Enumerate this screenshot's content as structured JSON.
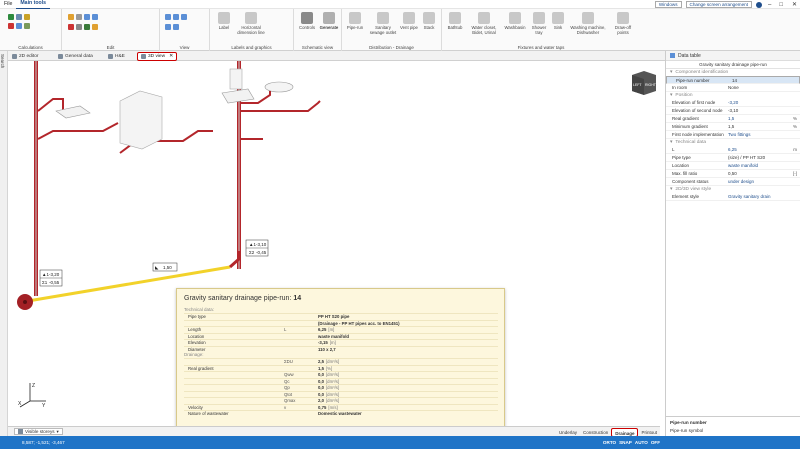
{
  "menu": {
    "file": "File",
    "main_tools": "Main tools",
    "windows": "Windows",
    "screen_arrangement": "Change screen arrangement"
  },
  "ribbon": {
    "groups": [
      {
        "label": "Calculations"
      },
      {
        "label": "Edit"
      },
      {
        "label": "View"
      },
      {
        "label": "Labels and graphics"
      },
      {
        "label": "Schematic view"
      },
      {
        "label": "Distribution - Drainage"
      },
      {
        "label": "Fixtures and water taps"
      }
    ],
    "buttons": [
      "Label",
      "Horizontal dimension line",
      "Controls",
      "Generate",
      "Pipe-run",
      "Sanitary sewage outlet",
      "Vent pipe",
      "Stack",
      "Bathtub",
      "Water closet, Bidet, Urinal",
      "Washbasin",
      "Shower tray",
      "Sink",
      "Washing machine, Dishwasher",
      "Draw-off points"
    ]
  },
  "tabs": [
    {
      "label": "2D editor"
    },
    {
      "label": "General data"
    },
    {
      "label": "H&E"
    },
    {
      "label": "3D view"
    }
  ],
  "side_tab": "Search",
  "viewcube": {
    "left": "LEFT",
    "right": "RIGHT"
  },
  "labels3d": {
    "l1a": "-3,10",
    "l1b": "-0,45",
    "l2a": "-3,20",
    "l2b": "-0,55",
    "l3": "1,50"
  },
  "tooltip": {
    "title_prefix": "Gravity sanitary drainage pipe-run:",
    "title_num": "14",
    "section1": "Technical data:",
    "section2": "Drainage:",
    "rows1": [
      {
        "a": "Pipe type",
        "b": "",
        "c": "PP HT S20 pipe",
        "u": ""
      },
      {
        "a": "",
        "b": "",
        "c": "(Drainage - PP HT pipes acc. to EN1451)",
        "u": ""
      },
      {
        "a": "Length",
        "b": "L",
        "c": "6,25",
        "u": "[m]"
      },
      {
        "a": "Location",
        "b": "",
        "c": "waste manifold",
        "u": ""
      },
      {
        "a": "Elevation",
        "b": "",
        "c": "-3,15",
        "u": "[m]"
      },
      {
        "a": "Diameter",
        "b": "",
        "c": "110 x 2,7",
        "u": ""
      }
    ],
    "rows2": [
      {
        "a": "",
        "b": "ΣDU",
        "c": "2,5",
        "u": "[dm³/s]"
      },
      {
        "a": "Real gradient",
        "b": "",
        "c": "1,5",
        "u": "[%]"
      },
      {
        "a": "",
        "b": "Qww",
        "c": "0,0",
        "u": "[dm³/s]"
      },
      {
        "a": "",
        "b": "Qc",
        "c": "0,0",
        "u": "[dm³/s]"
      },
      {
        "a": "",
        "b": "Qp",
        "c": "0,0",
        "u": "[dm³/s]"
      },
      {
        "a": "",
        "b": "Qtot",
        "c": "0,0",
        "u": "[dm³/s]"
      },
      {
        "a": "",
        "b": "Qmax",
        "c": "2,0",
        "u": "[dm³/s]"
      },
      {
        "a": "Velocity",
        "b": "v",
        "c": "0,75",
        "u": "[m/s]"
      },
      {
        "a": "Nature of wastewater",
        "b": "",
        "c": "Domestic wastewater",
        "u": ""
      }
    ]
  },
  "bottom": {
    "visible": "Visible storeys",
    "tabs": [
      "Underlay",
      "Construction",
      "Drainage",
      "Printout"
    ]
  },
  "status": {
    "coord": "8,587; -1,521; -3,467",
    "flags": [
      "ORTO",
      "SNAP",
      "AUTO",
      "OFF"
    ]
  },
  "datatable": {
    "title": "Data table",
    "subtitle": "Gravity sanitary drainage pipe-run",
    "sections": [
      {
        "name": "Component identification",
        "rows": [
          {
            "k": "Pipe-run number",
            "v": "14",
            "u": ""
          },
          {
            "k": "In room",
            "v": "None",
            "u": ""
          }
        ]
      },
      {
        "name": "Position",
        "rows": [
          {
            "k": "Elevation of first node",
            "v": "-3,20",
            "u": ""
          },
          {
            "k": "Elevation of second node",
            "v": "-3,10",
            "u": ""
          },
          {
            "k": "Real gradient",
            "v": "1,5",
            "u": "%"
          },
          {
            "k": "Minimum gradient",
            "v": "1,5",
            "u": "%"
          },
          {
            "k": "First node implementation",
            "v": "Two fittings",
            "u": ""
          }
        ]
      },
      {
        "name": "Technical data",
        "rows": [
          {
            "k": "L",
            "v": "6,25",
            "u": "m"
          },
          {
            "k": "Pipe type",
            "v": "(size) / PP HT S20",
            "u": ""
          },
          {
            "k": "Location",
            "v": "waste manifold",
            "u": ""
          },
          {
            "k": "Max. fill ratio",
            "v": "0,50",
            "u": "[-]"
          },
          {
            "k": "Component status",
            "v": "under design",
            "u": ""
          }
        ]
      },
      {
        "name": "2D/3D view style",
        "rows": [
          {
            "k": "Element style",
            "v": "Gravity sanitary drain",
            "u": ""
          }
        ]
      }
    ],
    "footer_title": "Pipe-run number",
    "footer_text": "Pipe-run symbol"
  },
  "colors": {
    "pipe_red": "#b3262b",
    "pipe_yellow": "#f2d22a",
    "status_blue": "#1f74c7",
    "accent": "#1f4e8c"
  }
}
